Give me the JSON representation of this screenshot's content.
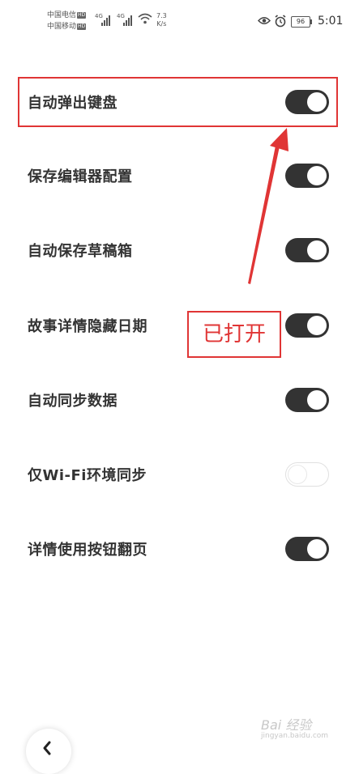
{
  "status_bar": {
    "carrier1": "中国电信",
    "carrier2": "中国移动",
    "hd": "HD",
    "network": "4G",
    "speed_value": "7.3",
    "speed_unit": "K/s",
    "battery": "96",
    "time": "5:01"
  },
  "settings": [
    {
      "label": "自动弹出键盘",
      "on": true
    },
    {
      "label": "保存编辑器配置",
      "on": true
    },
    {
      "label": "自动保存草稿箱",
      "on": true
    },
    {
      "label": "故事详情隐藏日期",
      "on": true
    },
    {
      "label": "自动同步数据",
      "on": true
    },
    {
      "label": "仅Wi-Fi环境同步",
      "on": false
    },
    {
      "label": "详情使用按钮翻页",
      "on": true
    }
  ],
  "annotation": {
    "callout_text": "已打开",
    "color": "#e03535"
  },
  "watermark": {
    "main": "Bai 经验",
    "sub": "jingyan.baidu.com"
  },
  "colors": {
    "toggle_on": "#333333",
    "toggle_off": "#ffffff",
    "accent_red": "#e03535"
  }
}
